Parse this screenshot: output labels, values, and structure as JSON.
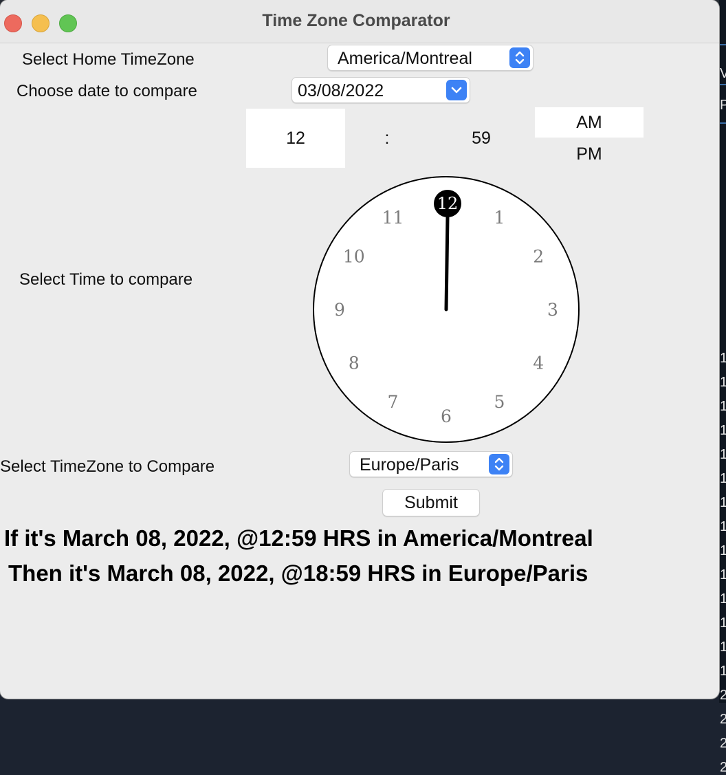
{
  "window": {
    "title": "Time Zone Comparator"
  },
  "home_timezone": {
    "label": "Select Home TimeZone",
    "selected": "America/Montreal"
  },
  "compare_date": {
    "label": "Choose date to compare",
    "value": "03/08/2022"
  },
  "time_picker": {
    "label": "Select Time to compare",
    "hour": "12",
    "separator": ":",
    "minute": "59",
    "am_label": "AM",
    "pm_label": "PM",
    "selected_period": "AM"
  },
  "clock": {
    "numbers": [
      "12",
      "1",
      "2",
      "3",
      "4",
      "5",
      "6",
      "7",
      "8",
      "9",
      "10",
      "11"
    ],
    "selected_hour": 12
  },
  "compare_timezone": {
    "label": "Select TimeZone to Compare",
    "selected": "Europe/Paris"
  },
  "submit_label": "Submit",
  "result": {
    "line1": "If it's March 08, 2022, @12:59 HRS in America/Montreal",
    "line2": "Then it's March 08, 2022, @18:59 HRS in Europe/Paris"
  },
  "colors": {
    "accent": "#3d82f5",
    "window_bg": "#ececec",
    "close": "#ed6a5e",
    "minimize": "#f5bf4f",
    "maximize": "#61c554"
  },
  "background_window": {
    "glyphs": [
      "V",
      "P",
      "1",
      "1",
      "1",
      "1",
      "1",
      "1",
      "1",
      "1",
      "1",
      "1",
      "1",
      "1",
      "1",
      "1",
      "2",
      "2",
      "2",
      "2"
    ]
  }
}
